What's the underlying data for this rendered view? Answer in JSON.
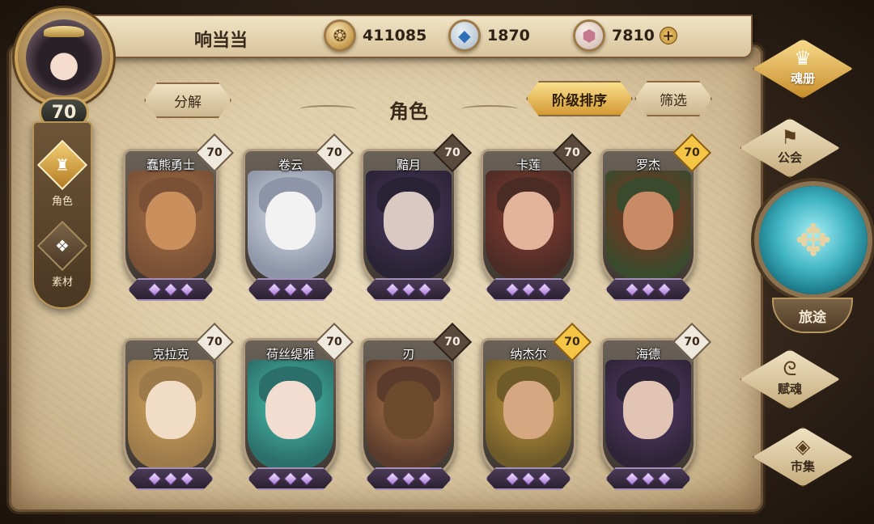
{
  "player": {
    "name": "响当当",
    "level": "70"
  },
  "currencies": [
    {
      "icon": "gold-coin-icon",
      "value": "411085"
    },
    {
      "icon": "blue-crystal-icon",
      "value": "1870"
    },
    {
      "icon": "prism-gem-icon",
      "value": "7810",
      "add": "+"
    }
  ],
  "left_tabs": [
    {
      "label": "角色",
      "icon": "helmet-icon",
      "active": true
    },
    {
      "label": "素材",
      "icon": "material-icon",
      "active": false
    }
  ],
  "toolbar": {
    "decompose": "分解",
    "title": "角色",
    "sort": "阶级排序",
    "filter": "筛选"
  },
  "heroes": [
    {
      "name": "蠢熊勇士",
      "level": "70",
      "badge": "light"
    },
    {
      "name": "卷云",
      "level": "70",
      "badge": "light"
    },
    {
      "name": "黯月",
      "level": "70",
      "badge": "dark"
    },
    {
      "name": "卡莲",
      "level": "70",
      "badge": "dark"
    },
    {
      "name": "罗杰",
      "level": "70",
      "badge": "gold"
    },
    {
      "name": "克拉克",
      "level": "70",
      "badge": "light"
    },
    {
      "name": "荷丝缇雅",
      "level": "70",
      "badge": "light"
    },
    {
      "name": "刃",
      "level": "70",
      "badge": "dark"
    },
    {
      "name": "纳杰尔",
      "level": "70",
      "badge": "gold"
    },
    {
      "name": "海德",
      "level": "70",
      "badge": "light"
    }
  ],
  "right_menu": {
    "soul_book": "魂册",
    "guild": "公会",
    "journey": "旅途",
    "endow": "赋魂",
    "market": "市集"
  }
}
